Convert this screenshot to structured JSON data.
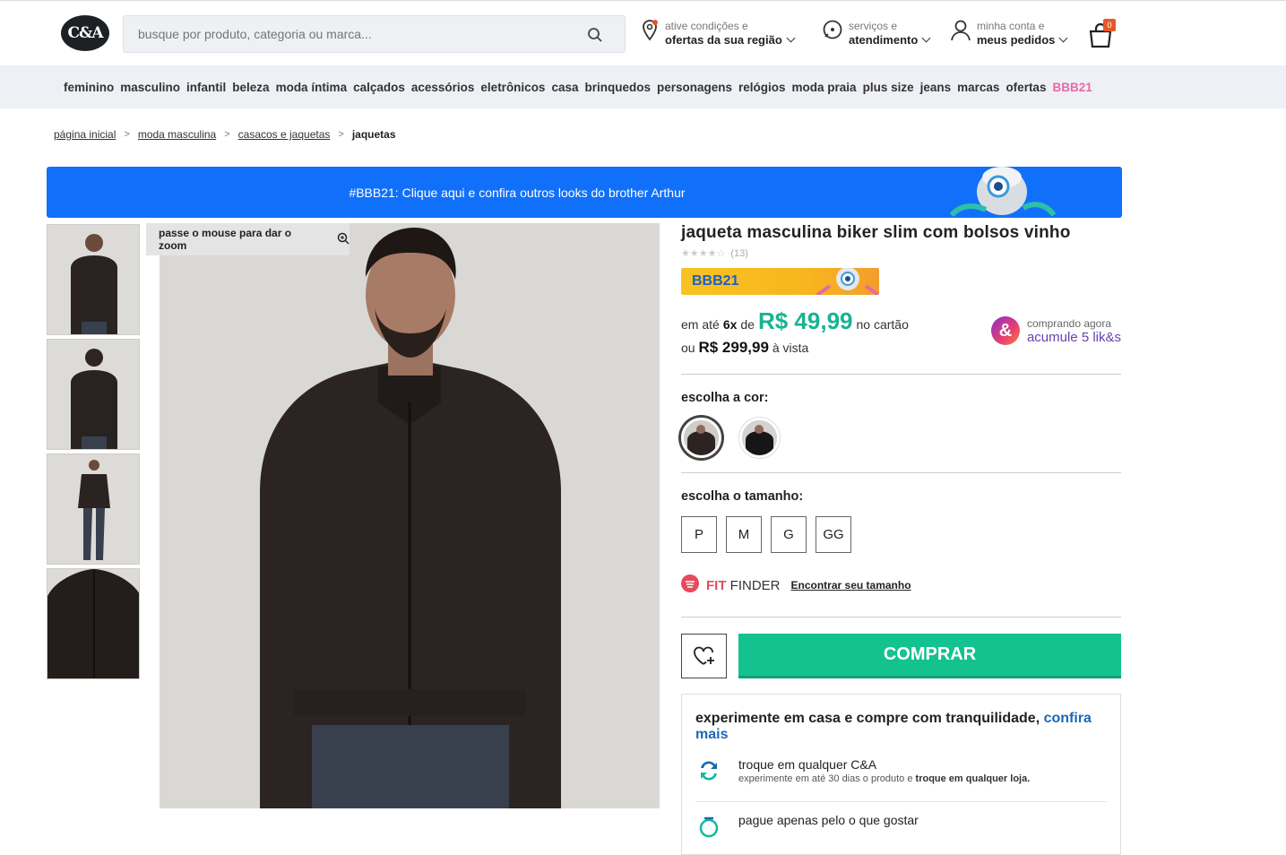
{
  "header": {
    "logo": "C&A",
    "search_placeholder": "busque por produto, categoria ou marca...",
    "region_small": "ative condições e",
    "region_big": "ofertas da sua região",
    "services_small": "serviços e",
    "services_big": "atendimento",
    "account_small": "minha conta e",
    "account_big": "meus pedidos",
    "cart_count": "0"
  },
  "nav": [
    "feminino",
    "masculino",
    "infantil",
    "beleza",
    "moda íntima",
    "calçados",
    "acessórios",
    "eletrônicos",
    "casa",
    "brinquedos",
    "personagens",
    "relógios",
    "moda praia",
    "plus size",
    "jeans",
    "marcas",
    "ofertas",
    "BBB21"
  ],
  "breadcrumb": {
    "items": [
      "página inicial",
      "moda masculina",
      "casacos e jaquetas"
    ],
    "separator": ">",
    "current": "jaquetas"
  },
  "banner": {
    "text": "#BBB21: Clique aqui e confira outros looks do brother Arthur"
  },
  "zoom_tip": "passe o mouse para dar o zoom",
  "product": {
    "title": "jaqueta masculina biker slim com bolsos vinho",
    "stars": "★★★★☆",
    "review_count": "(13)",
    "tag": "BBB21",
    "installment_prefix": "em até",
    "installments": "6x",
    "installment_de": "de",
    "installment_value": "R$ 49,99",
    "installment_suffix": "no cartão",
    "cash_prefix": "ou",
    "cash_value": "R$ 299,99",
    "cash_suffix": "à vista",
    "likes_small": "comprando agora",
    "likes_big": "acumule 5 lik&s",
    "likes_icon": "&",
    "color_label": "escolha a cor:",
    "size_label": "escolha o tamanho:",
    "sizes": [
      "P",
      "M",
      "G",
      "GG"
    ],
    "fit_label": "FIT",
    "fit_finder": "FINDER",
    "fit_link": "Encontrar seu tamanho",
    "buy_label": "COMPRAR"
  },
  "benefits": {
    "head": "experimente em casa e compre com tranquilidade,",
    "head_link": "confira mais",
    "b1_title": "troque em qualquer C&A",
    "b1_desc": "experimente em até 30 dias o produto e",
    "b1_desc_bold": "troque em qualquer loja.",
    "b2_title": "pague apenas pelo o que gostar"
  },
  "colors": {
    "accent": "#14c28f",
    "banner": "#1170fa",
    "price": "#18b392",
    "pink": "#e56aa5"
  }
}
